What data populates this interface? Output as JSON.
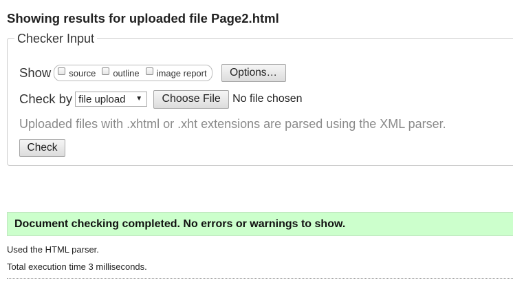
{
  "header": {
    "title": "Showing results for uploaded file Page2.html"
  },
  "checker": {
    "legend": "Checker Input",
    "show_label": "Show",
    "show_options": [
      {
        "label": "source",
        "checked": false
      },
      {
        "label": "outline",
        "checked": false
      },
      {
        "label": "image report",
        "checked": false
      }
    ],
    "options_button": "Options…",
    "check_by_label": "Check by",
    "check_by_selected": "file upload",
    "choose_file_button": "Choose File",
    "file_status": "No file chosen",
    "note": "Uploaded files with .xhtml or .xht extensions are parsed using the XML parser.",
    "check_button": "Check"
  },
  "results": {
    "success_message": "Document checking completed. No errors or warnings to show.",
    "success_color": "#ccffcc",
    "parser_info": "Used the HTML parser.",
    "execution_time": "Total execution time 3 milliseconds."
  }
}
